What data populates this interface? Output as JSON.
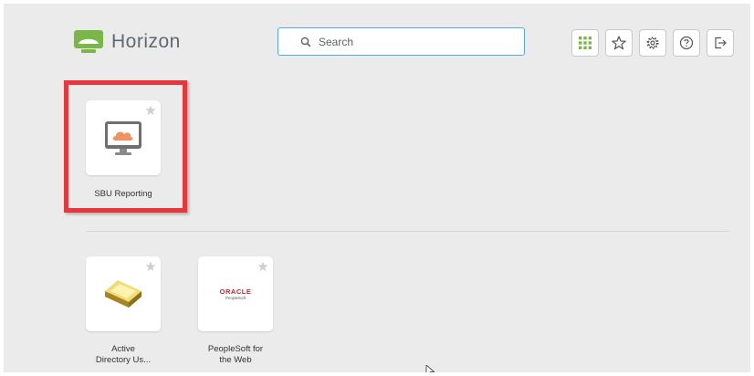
{
  "header": {
    "logo_text": "Horizon",
    "search_placeholder": "Search",
    "toolbar": [
      {
        "name": "apps-grid",
        "icon": "grid-icon"
      },
      {
        "name": "favorites",
        "icon": "star-icon"
      },
      {
        "name": "settings",
        "icon": "gear-icon"
      },
      {
        "name": "help",
        "icon": "help-icon"
      },
      {
        "name": "logout",
        "icon": "logout-icon"
      }
    ]
  },
  "favorites_section": {
    "apps": [
      {
        "label": "SBU Reporting",
        "icon": "remote-desktop-icon"
      }
    ]
  },
  "apps_section": {
    "apps": [
      {
        "label_line1": "Active",
        "label_line2": "Directory Us...",
        "icon": "active-directory-icon"
      },
      {
        "label_line1": "PeopleSoft for",
        "label_line2": "the Web",
        "icon": "oracle-peoplesoft-icon",
        "logo_line1": "ORACLE",
        "logo_line2": "PeopleSoft"
      }
    ]
  },
  "colors": {
    "accent": "#55a8e0",
    "logo_green": "#7ab648",
    "highlight_red": "#e8363a",
    "cloud_orange": "#f29260"
  }
}
